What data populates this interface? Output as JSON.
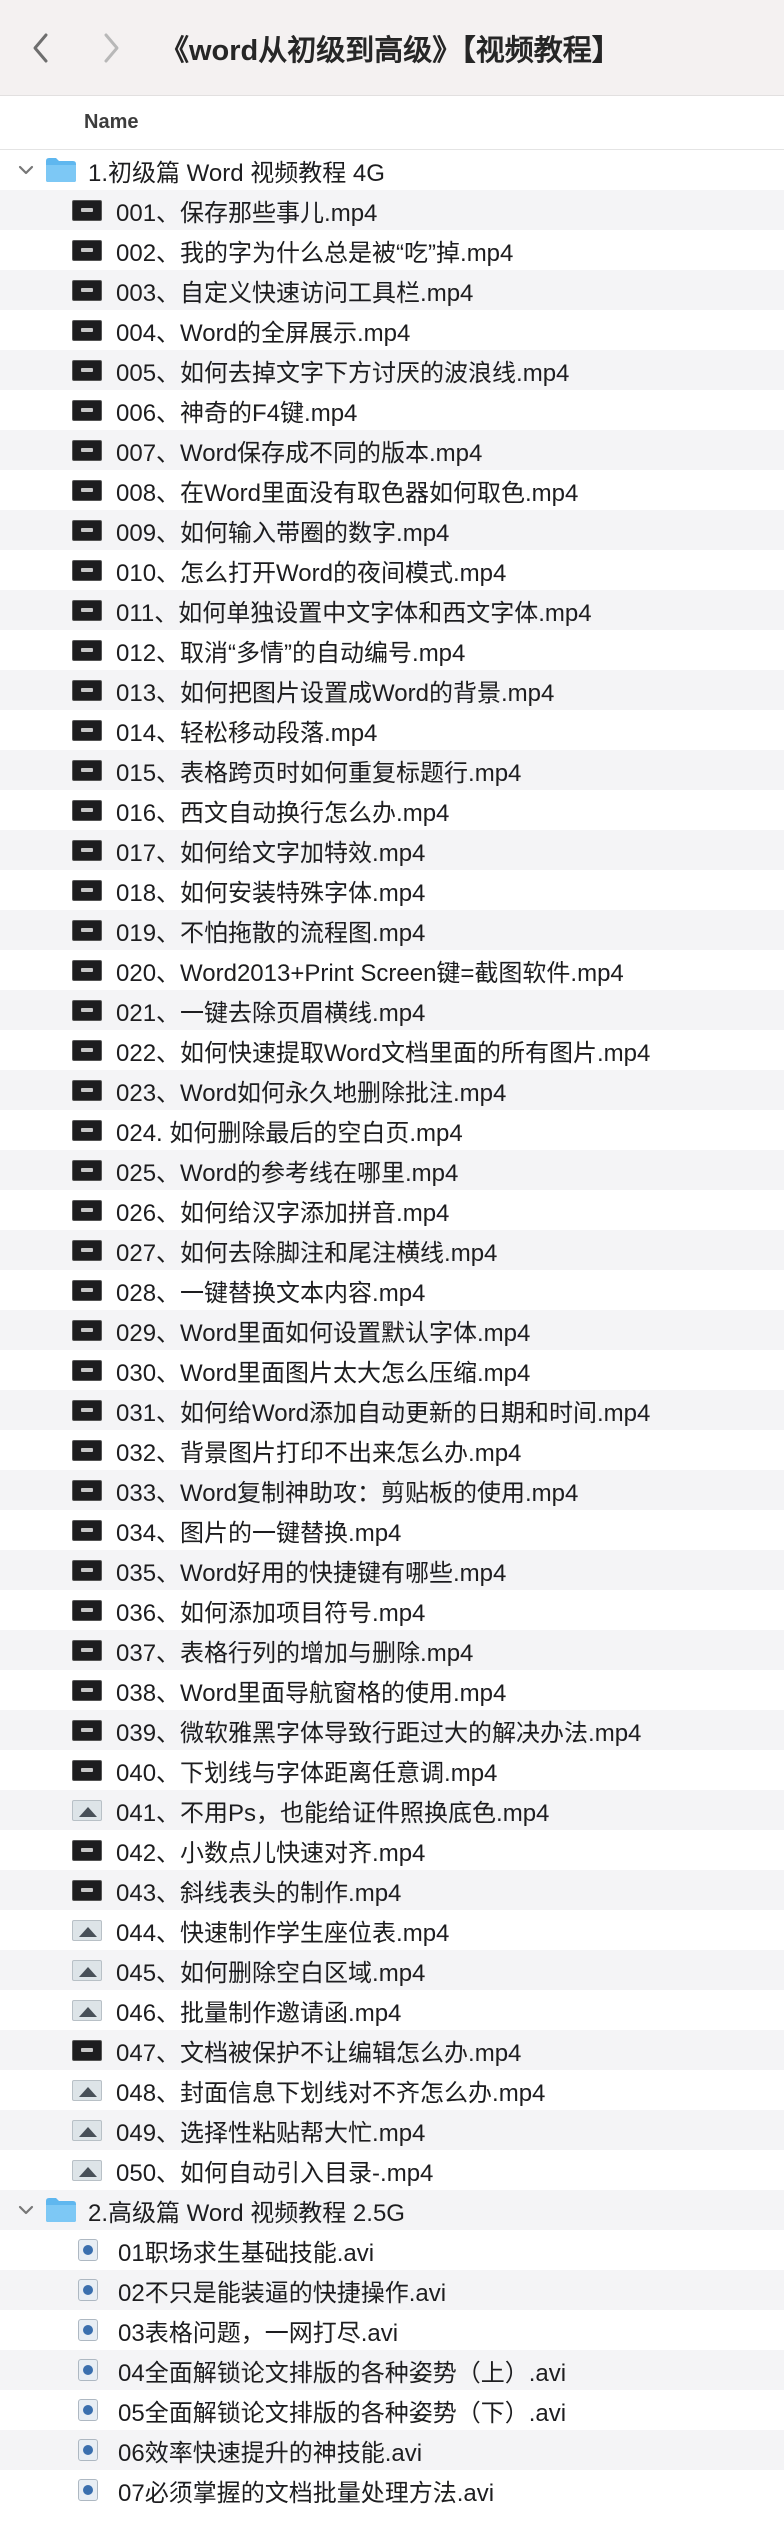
{
  "toolbar": {
    "back_icon": "chevron-left-icon",
    "forward_icon": "chevron-right-icon",
    "title": "《word从初级到高级》【视频教程】"
  },
  "columns": {
    "name": "Name"
  },
  "folders": [
    {
      "label": "1.初级篇 Word 视频教程 4G",
      "icon": "folder-icon",
      "files": [
        {
          "name": "001、保存那些事儿.mp4",
          "icon": "dark"
        },
        {
          "name": "002、我的字为什么总是被“吃”掉.mp4",
          "icon": "dark"
        },
        {
          "name": "003、自定义快速访问工具栏.mp4",
          "icon": "dark"
        },
        {
          "name": "004、Word的全屏展示.mp4",
          "icon": "dark"
        },
        {
          "name": "005、如何去掉文字下方讨厌的波浪线.mp4",
          "icon": "dark"
        },
        {
          "name": "006、神奇的F4键.mp4",
          "icon": "dark"
        },
        {
          "name": "007、Word保存成不同的版本.mp4",
          "icon": "dark"
        },
        {
          "name": "008、在Word里面没有取色器如何取色.mp4",
          "icon": "dark"
        },
        {
          "name": "009、如何输入带圈的数字.mp4",
          "icon": "dark"
        },
        {
          "name": "010、怎么打开Word的夜间模式.mp4",
          "icon": "dark"
        },
        {
          "name": "011、如何单独设置中文字体和西文字体.mp4",
          "icon": "dark"
        },
        {
          "name": "012、取消“多情”的自动编号.mp4",
          "icon": "dark"
        },
        {
          "name": "013、如何把图片设置成Word的背景.mp4",
          "icon": "dark"
        },
        {
          "name": "014、轻松移动段落.mp4",
          "icon": "dark"
        },
        {
          "name": "015、表格跨页时如何重复标题行.mp4",
          "icon": "dark"
        },
        {
          "name": "016、西文自动换行怎么办.mp4",
          "icon": "dark"
        },
        {
          "name": "017、如何给文字加特效.mp4",
          "icon": "dark"
        },
        {
          "name": "018、如何安装特殊字体.mp4",
          "icon": "dark"
        },
        {
          "name": "019、不怕拖散的流程图.mp4",
          "icon": "dark"
        },
        {
          "name": "020、Word2013+Print Screen键=截图软件.mp4",
          "icon": "dark"
        },
        {
          "name": "021、一键去除页眉横线.mp4",
          "icon": "dark"
        },
        {
          "name": "022、如何快速提取Word文档里面的所有图片.mp4",
          "icon": "dark"
        },
        {
          "name": "023、Word如何永久地删除批注.mp4",
          "icon": "dark"
        },
        {
          "name": "024. 如何删除最后的空白页.mp4",
          "icon": "dark"
        },
        {
          "name": "025、Word的参考线在哪里.mp4",
          "icon": "dark"
        },
        {
          "name": "026、如何给汉字添加拼音.mp4",
          "icon": "dark"
        },
        {
          "name": "027、如何去除脚注和尾注横线.mp4",
          "icon": "dark"
        },
        {
          "name": "028、一键替换文本内容.mp4",
          "icon": "dark"
        },
        {
          "name": "029、Word里面如何设置默认字体.mp4",
          "icon": "dark"
        },
        {
          "name": "030、Word里面图片太大怎么压缩.mp4",
          "icon": "dark"
        },
        {
          "name": "031、如何给Word添加自动更新的日期和时间.mp4",
          "icon": "dark"
        },
        {
          "name": "032、背景图片打印不出来怎么办.mp4",
          "icon": "dark"
        },
        {
          "name": "033、Word复制神助攻：剪贴板的使用.mp4",
          "icon": "dark"
        },
        {
          "name": "034、图片的一键替换.mp4",
          "icon": "dark"
        },
        {
          "name": "035、Word好用的快捷键有哪些.mp4",
          "icon": "dark"
        },
        {
          "name": "036、如何添加项目符号.mp4",
          "icon": "dark"
        },
        {
          "name": "037、表格行列的增加与删除.mp4",
          "icon": "dark"
        },
        {
          "name": "038、Word里面导航窗格的使用.mp4",
          "icon": "dark"
        },
        {
          "name": "039、微软雅黑字体导致行距过大的解决办法.mp4",
          "icon": "dark"
        },
        {
          "name": "040、下划线与字体距离任意调.mp4",
          "icon": "dark"
        },
        {
          "name": "041、不用Ps，也能给证件照换底色.mp4",
          "icon": "img"
        },
        {
          "name": "042、小数点儿快速对齐.mp4",
          "icon": "dark"
        },
        {
          "name": "043、斜线表头的制作.mp4",
          "icon": "dark"
        },
        {
          "name": "044、快速制作学生座位表.mp4",
          "icon": "img"
        },
        {
          "name": "045、如何删除空白区域.mp4",
          "icon": "img"
        },
        {
          "name": "046、批量制作邀请函.mp4",
          "icon": "img"
        },
        {
          "name": "047、文档被保护不让编辑怎么办.mp4",
          "icon": "dark"
        },
        {
          "name": "048、封面信息下划线对不齐怎么办.mp4",
          "icon": "img"
        },
        {
          "name": "049、选择性粘贴帮大忙.mp4",
          "icon": "img"
        },
        {
          "name": "050、如何自动引入目录-.mp4",
          "icon": "img"
        }
      ]
    },
    {
      "label": "2.高级篇 Word 视频教程 2.5G",
      "icon": "folder-icon",
      "files": [
        {
          "name": "01职场求生基础技能.avi",
          "icon": "avi"
        },
        {
          "name": "02不只是能装逼的快捷操作.avi",
          "icon": "avi"
        },
        {
          "name": "03表格问题，一网打尽.avi",
          "icon": "avi"
        },
        {
          "name": "04全面解锁论文排版的各种姿势（上）.avi",
          "icon": "avi"
        },
        {
          "name": "05全面解锁论文排版的各种姿势（下）.avi",
          "icon": "avi"
        },
        {
          "name": "06效率快速提升的神技能.avi",
          "icon": "avi"
        },
        {
          "name": "07必须掌握的文档批量处理方法.avi",
          "icon": "avi"
        }
      ]
    }
  ]
}
